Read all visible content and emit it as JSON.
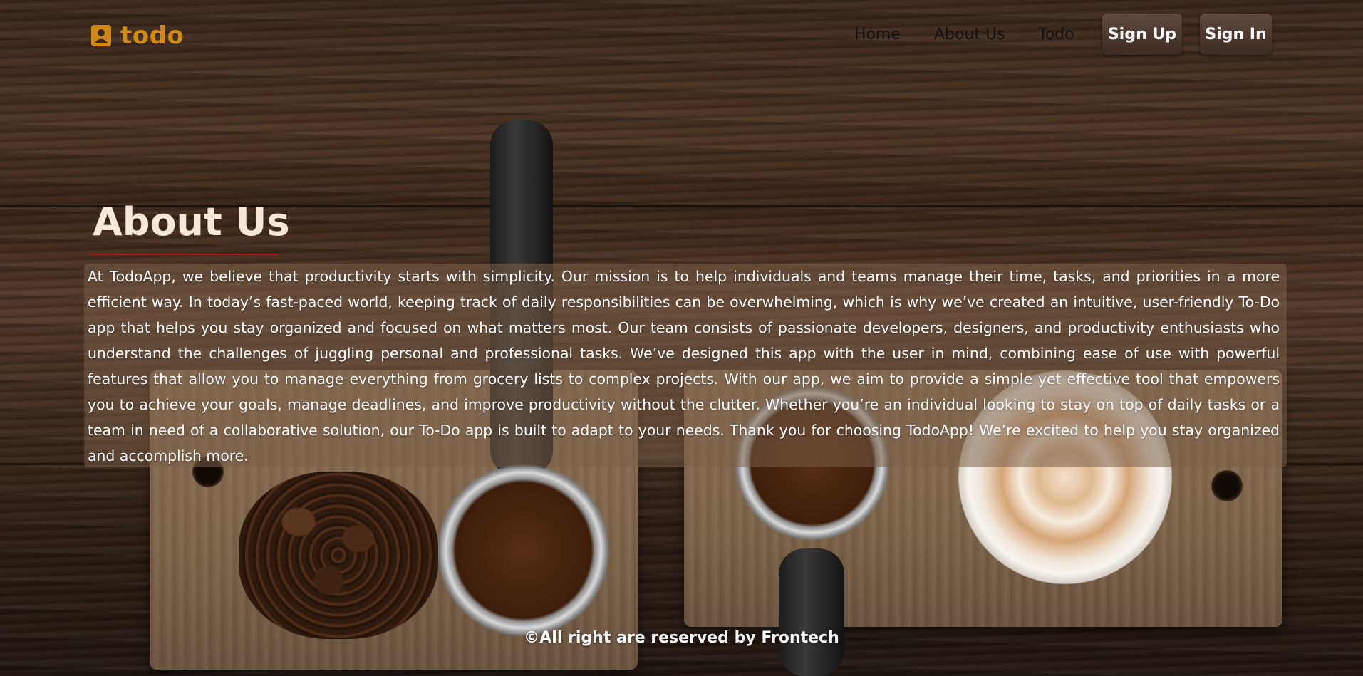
{
  "nav": {
    "brand": "todo",
    "brand_icon": "address-book-icon",
    "brand_color": "#d08a17",
    "links": [
      "Home",
      "About Us",
      "Todo"
    ],
    "signup_label": "Sign Up",
    "signin_label": "Sign In"
  },
  "about": {
    "title": "About Us",
    "body": "At TodoApp, we believe that productivity starts with simplicity. Our mission is to help individuals and teams manage their time, tasks, and priorities in a more efficient way. In today’s fast-paced world, keeping track of daily responsibilities can be overwhelming, which is why we’ve created an intuitive, user-friendly To-Do app that helps you stay organized and focused on what matters most. Our team consists of passionate developers, designers, and productivity enthusiasts who understand the challenges of juggling personal and professional tasks. We’ve designed this app with the user in mind, combining ease of use with powerful features that allow you to manage everything from grocery lists to complex projects. With our app, we aim to provide a simple yet effective tool that empowers you to achieve your goals, manage deadlines, and improve productivity without the clutter. Whether you’re an individual looking to stay on top of daily tasks or a team in need of a collaborative solution, our To-Do app is built to adapt to your needs. Thank you for choosing TodoApp! We’re excited to help you stay organized and accomplish more."
  },
  "footer": {
    "text": "©All right are reserved by Frontech"
  }
}
